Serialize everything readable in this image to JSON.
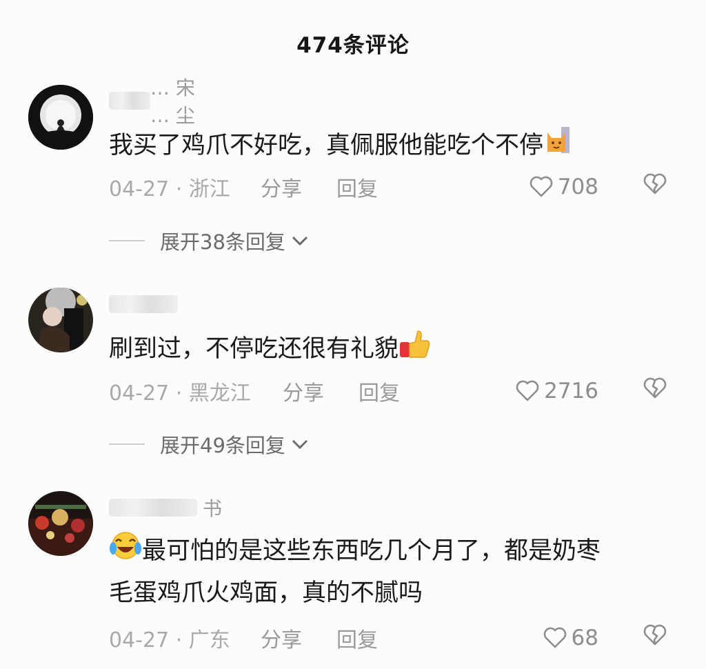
{
  "header": {
    "title": "474条评论"
  },
  "comments": [
    {
      "username": "… 宋 … 尘",
      "text": "我买了鸡爪不好吃，真佩服他能吃个不停",
      "emoji": "cat-emoji",
      "date": "04-27 · 浙江",
      "share": "分享",
      "reply": "回复",
      "likes": "708",
      "expand": "展开38条回复"
    },
    {
      "username": "",
      "text": "刷到过，不停吃还很有礼貌",
      "emoji": "thumbs-up-emoji",
      "date": "04-27 · 黑龙江",
      "share": "分享",
      "reply": "回复",
      "likes": "2716",
      "expand": "展开49条回复"
    },
    {
      "username": "书",
      "text_line1": "最可怕的是这些东西吃几个月了，都是奶枣",
      "text_line2": "毛蛋鸡爪火鸡面，真的不腻吗",
      "emoji": "laughing-crying-emoji",
      "date": "04-27 · 广东",
      "share": "分享",
      "reply": "回复",
      "likes": "68"
    }
  ]
}
